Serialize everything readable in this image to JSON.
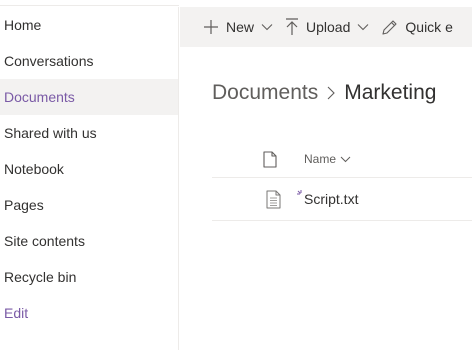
{
  "sidebar": {
    "items": [
      {
        "label": "Home"
      },
      {
        "label": "Conversations"
      },
      {
        "label": "Documents"
      },
      {
        "label": "Shared with us"
      },
      {
        "label": "Notebook"
      },
      {
        "label": "Pages"
      },
      {
        "label": "Site contents"
      },
      {
        "label": "Recycle bin"
      },
      {
        "label": "Edit"
      }
    ],
    "selected": "Documents"
  },
  "command_bar": {
    "new_label": "New",
    "upload_label": "Upload",
    "quick_edit_label": "Quick e"
  },
  "breadcrumb": {
    "root": "Documents",
    "current": "Marketing"
  },
  "table": {
    "name_header": "Name",
    "rows": [
      {
        "name": "Script.txt"
      }
    ]
  },
  "colors": {
    "accent": "#7a5aa6",
    "selected_bg": "#f3f2f1",
    "command_bar_bg": "#f3f2f1"
  }
}
